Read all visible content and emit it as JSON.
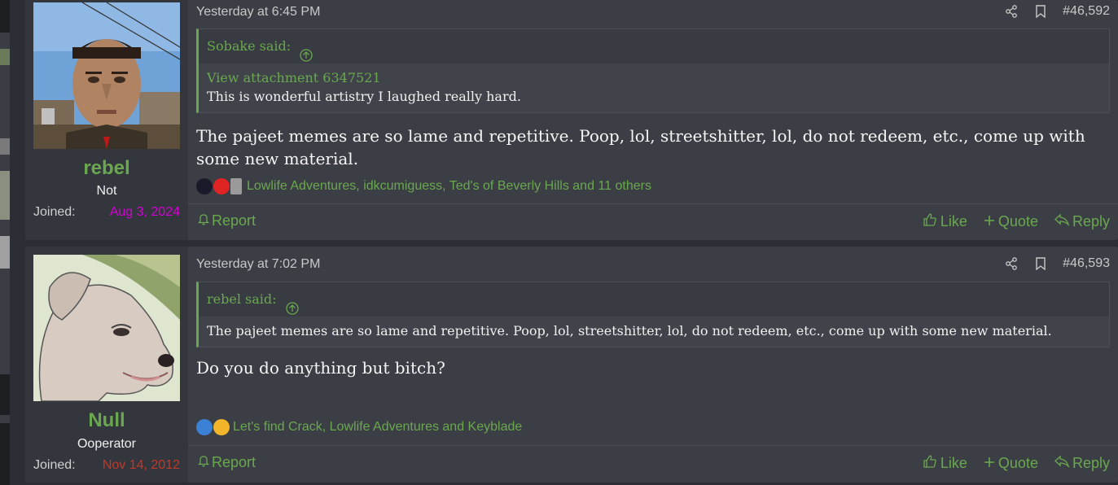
{
  "posts": [
    {
      "username": "rebel",
      "user_title": "Not",
      "joined_label": "Joined:",
      "joined_date": "Aug 3, 2024",
      "joined_color": "#d400d4",
      "timestamp": "Yesterday at 6:45 PM",
      "post_number": "#46,592",
      "quote": {
        "author_line": "Sobake said:",
        "attachment": "View attachment 6347521",
        "text": "This is wonderful artistry I laughed really hard."
      },
      "message": "The pajeet memes are so lame and repetitive. Poop, lol, streetshitter, lol, do not redeem, etc., come up with some new material.",
      "reactions": "Lowlife Adventures, idkcumiguess, Ted's of Beverly Hills and 11 others",
      "report": "Report",
      "like": "Like",
      "quote_btn": "Quote",
      "reply": "Reply"
    },
    {
      "username": "Null",
      "user_title": "Ooperator",
      "joined_label": "Joined:",
      "joined_date": "Nov 14, 2012",
      "joined_color": "#c0392b",
      "timestamp": "Yesterday at 7:02 PM",
      "post_number": "#46,593",
      "quote": {
        "author_line": "rebel said:",
        "text": "The pajeet memes are so lame and repetitive. Poop, lol, streetshitter, lol, do not redeem, etc., come up with some new material."
      },
      "message": "Do you do anything but bitch?",
      "reactions": "Let's find Crack, Lowlife Adventures and Keyblade",
      "report": "Report",
      "like": "Like",
      "quote_btn": "Quote",
      "reply": "Reply"
    }
  ],
  "colors": {
    "accent": "#6aa84f",
    "post_bg": "#3b3e44",
    "user_cell_bg": "#33363c"
  }
}
